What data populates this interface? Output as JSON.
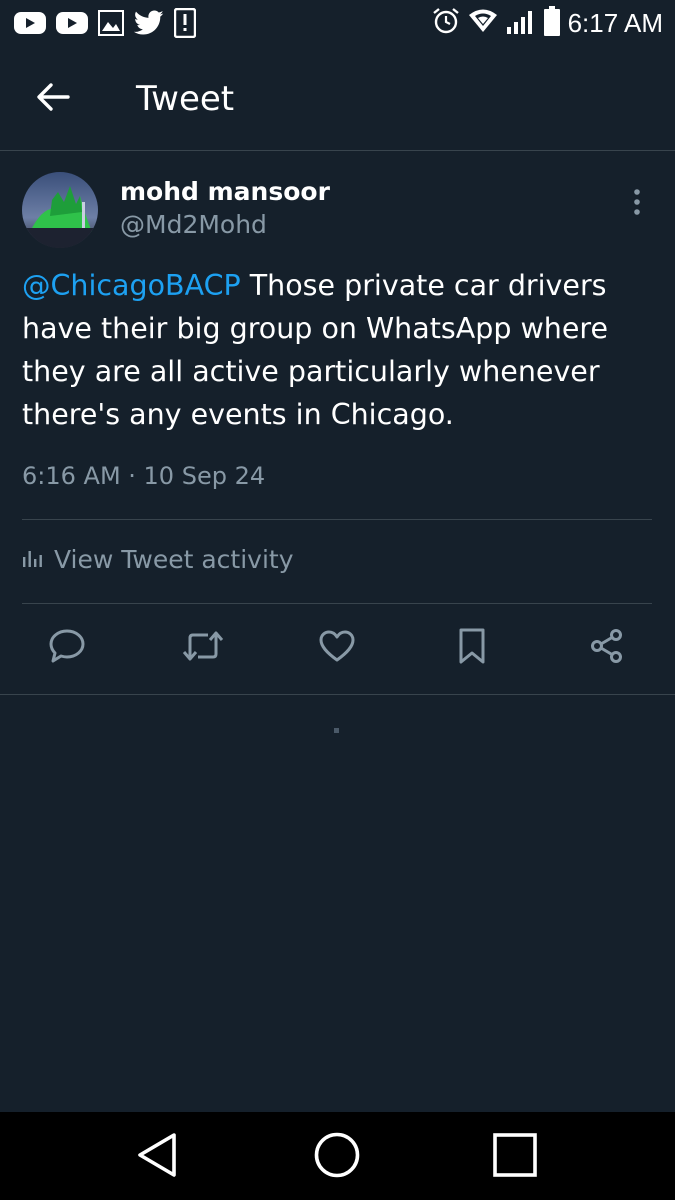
{
  "status_bar": {
    "time": "6:17 AM",
    "left_icons": [
      "youtube-icon",
      "youtube-icon",
      "gallery-icon",
      "twitter-icon",
      "alert-icon"
    ],
    "right_icons": [
      "alarm-icon",
      "wifi-icon",
      "signal-icon",
      "battery-icon"
    ]
  },
  "header": {
    "title": "Tweet",
    "back_icon": "arrow-left-icon"
  },
  "tweet": {
    "author_name": "mohd mansoor",
    "author_handle": "@Md2Mohd",
    "mention": "@ChicagoBACP",
    "body": " Those private car drivers have their big group on WhatsApp where they are all active particularly whenever there's any events in Chicago.",
    "timestamp": "6:16 AM · 10 Sep 24",
    "activity_label": "View Tweet activity"
  },
  "actions": [
    "reply-icon",
    "retweet-icon",
    "like-icon",
    "bookmark-icon",
    "share-icon"
  ],
  "nav": [
    "back-triangle-icon",
    "home-circle-icon",
    "recents-square-icon"
  ],
  "colors": {
    "background": "#15202b",
    "accent": "#1da1f2",
    "secondary_text": "#8899a6",
    "divider": "#38444d"
  }
}
